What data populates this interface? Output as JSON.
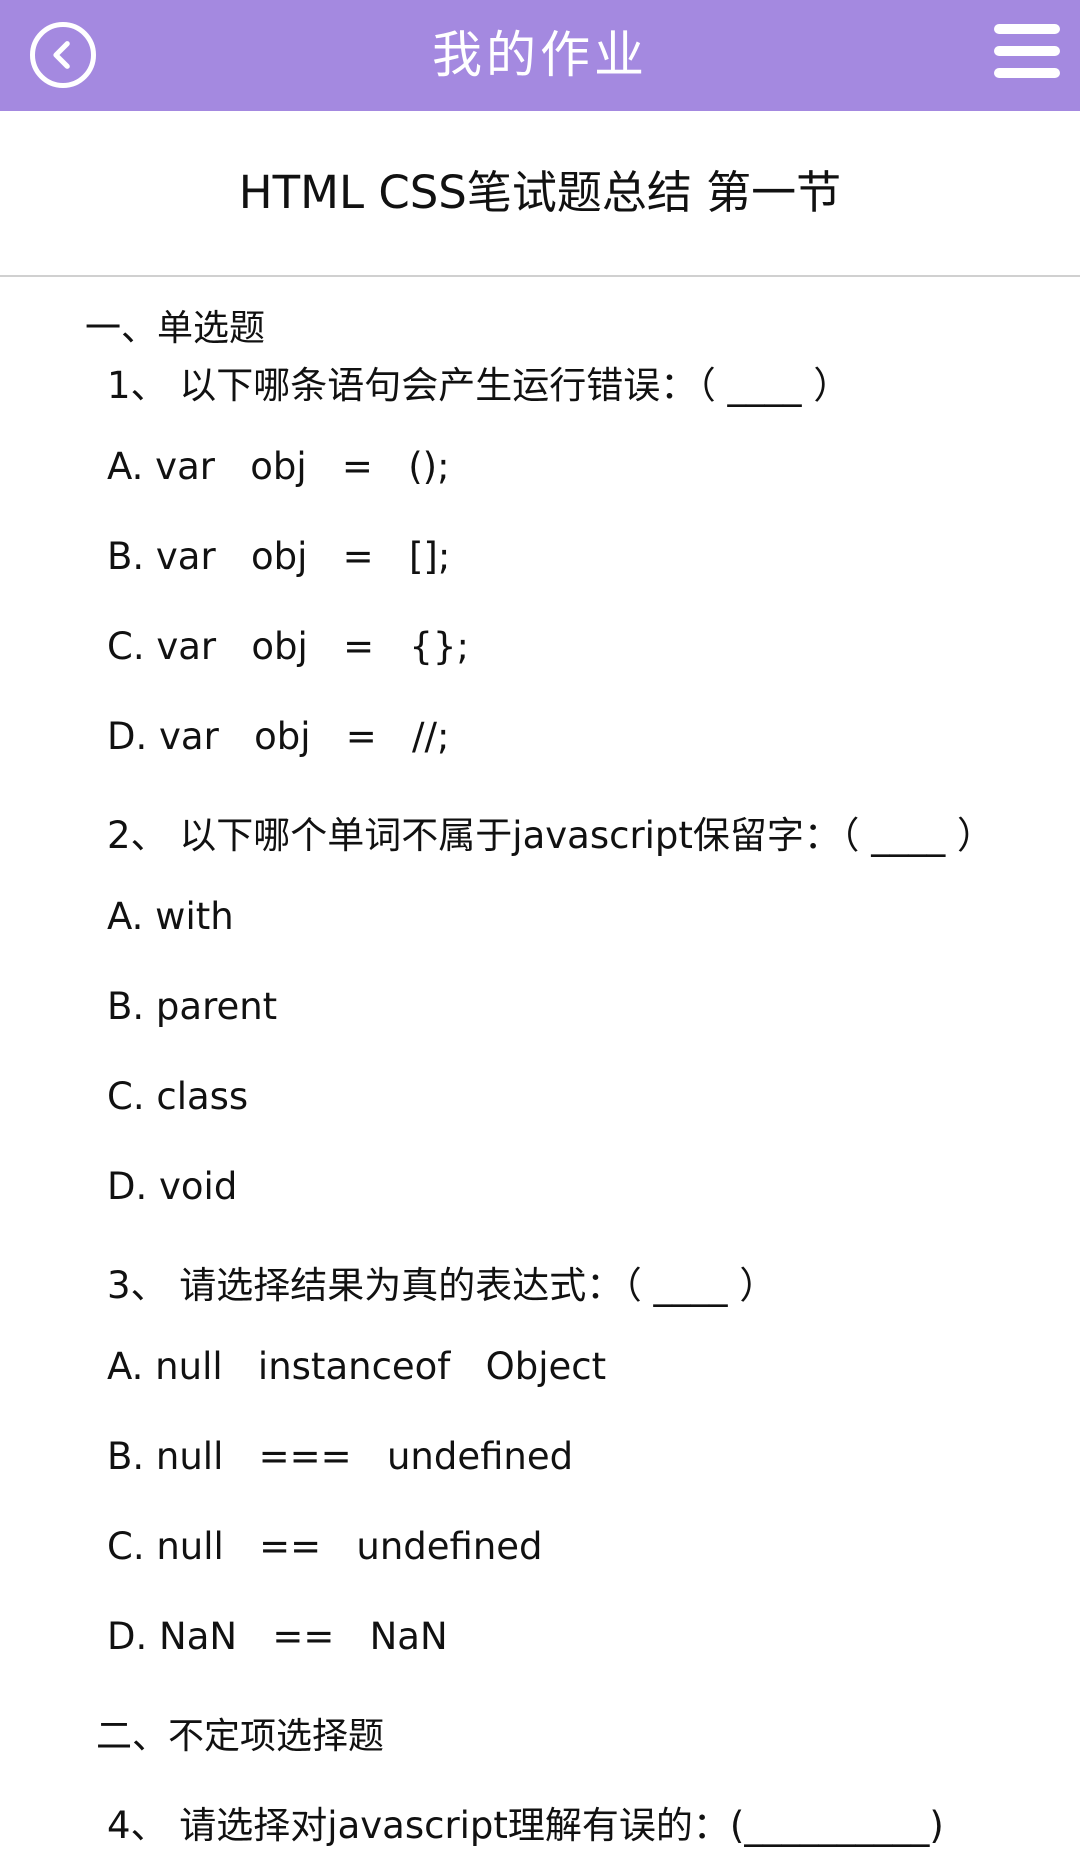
{
  "header": {
    "title": "我的作业"
  },
  "doc": {
    "title": "HTML CSS笔试题总结 第一节"
  },
  "content": {
    "sections": [
      {
        "label": "一、单选题"
      },
      {
        "label": "二、不定项选择题"
      }
    ],
    "questions": [
      {
        "text": "1、 以下哪条语句会产生运行错误：（ ____ ）",
        "options": [
          "A. var   obj   =   ();",
          "B. var   obj   =   [];",
          "C. var   obj   =   {};",
          "D. var   obj   =   //;"
        ]
      },
      {
        "text": "2、 以下哪个单词不属于javascript保留字：（ ____ ）",
        "options": [
          "A. with",
          "B. parent",
          "C. class",
          "D. void"
        ]
      },
      {
        "text": "3、 请选择结果为真的表达式：（ ____ ）",
        "options": [
          "A. null   instanceof   Object",
          "B. null   ===   undefined",
          "C. null   ==   undefined",
          "D. NaN   ==   NaN"
        ]
      },
      {
        "text": "4、 请选择对javascript理解有误的：(__________)"
      }
    ]
  },
  "colors": {
    "header_bg": "#a489e0",
    "header_fg": "#ffffff",
    "divider": "#d0d0d0"
  }
}
